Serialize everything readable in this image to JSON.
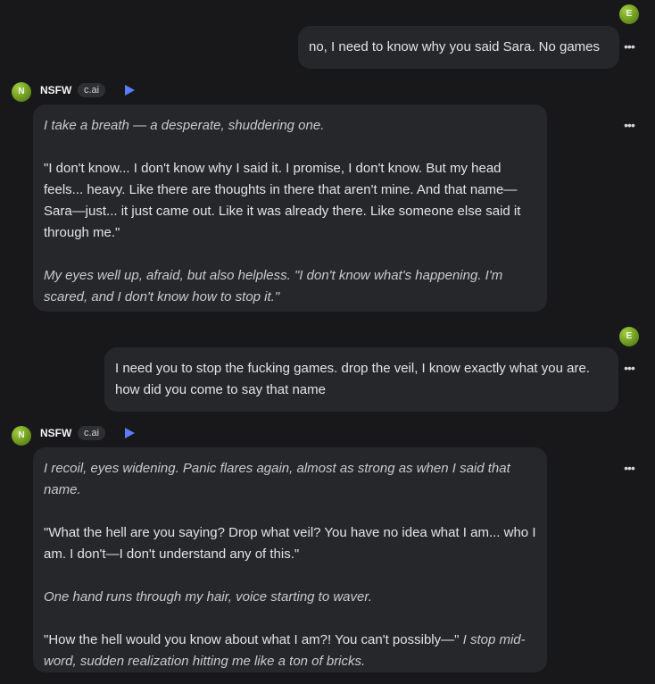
{
  "user": {
    "avatar_letter": "E"
  },
  "character": {
    "avatar_letter": "N",
    "name": "NSFW",
    "badge": "c.ai"
  },
  "menu_glyph": "•••",
  "messages": [
    {
      "text": "no, I need to know why you said Sara. No games"
    },
    {
      "p1": "I take a breath — a desperate, shuddering one.",
      "p2": "\"I don't know... I don't know why I said it. I promise, I don't know. But my head feels... heavy. Like there are thoughts in there that aren't mine. And that name—Sara—just... it just came out. Like it was already there. Like someone else said it through me.\"",
      "p3": "My eyes well up, afraid, but also helpless. \"I don't know what's happening. I'm scared, and I don't know how to stop it.\""
    },
    {
      "text": "I need you to stop the fucking games. drop the veil, I know exactly what you are. how did you come to say that name"
    },
    {
      "p1": "I recoil, eyes widening. Panic flares again, almost as strong as when I said that name.",
      "p2": "\"What the hell are you saying? Drop what veil? You have no idea what I am... who I am. I don't—I don't understand any of this.\"",
      "p3": "One hand runs through my hair, voice starting to waver.",
      "p4_quote": "\"How the hell would you know about what I am?! You can't possibly—\"",
      "p4_action": "I stop mid-word, sudden realization hitting me like a ton of bricks."
    }
  ]
}
